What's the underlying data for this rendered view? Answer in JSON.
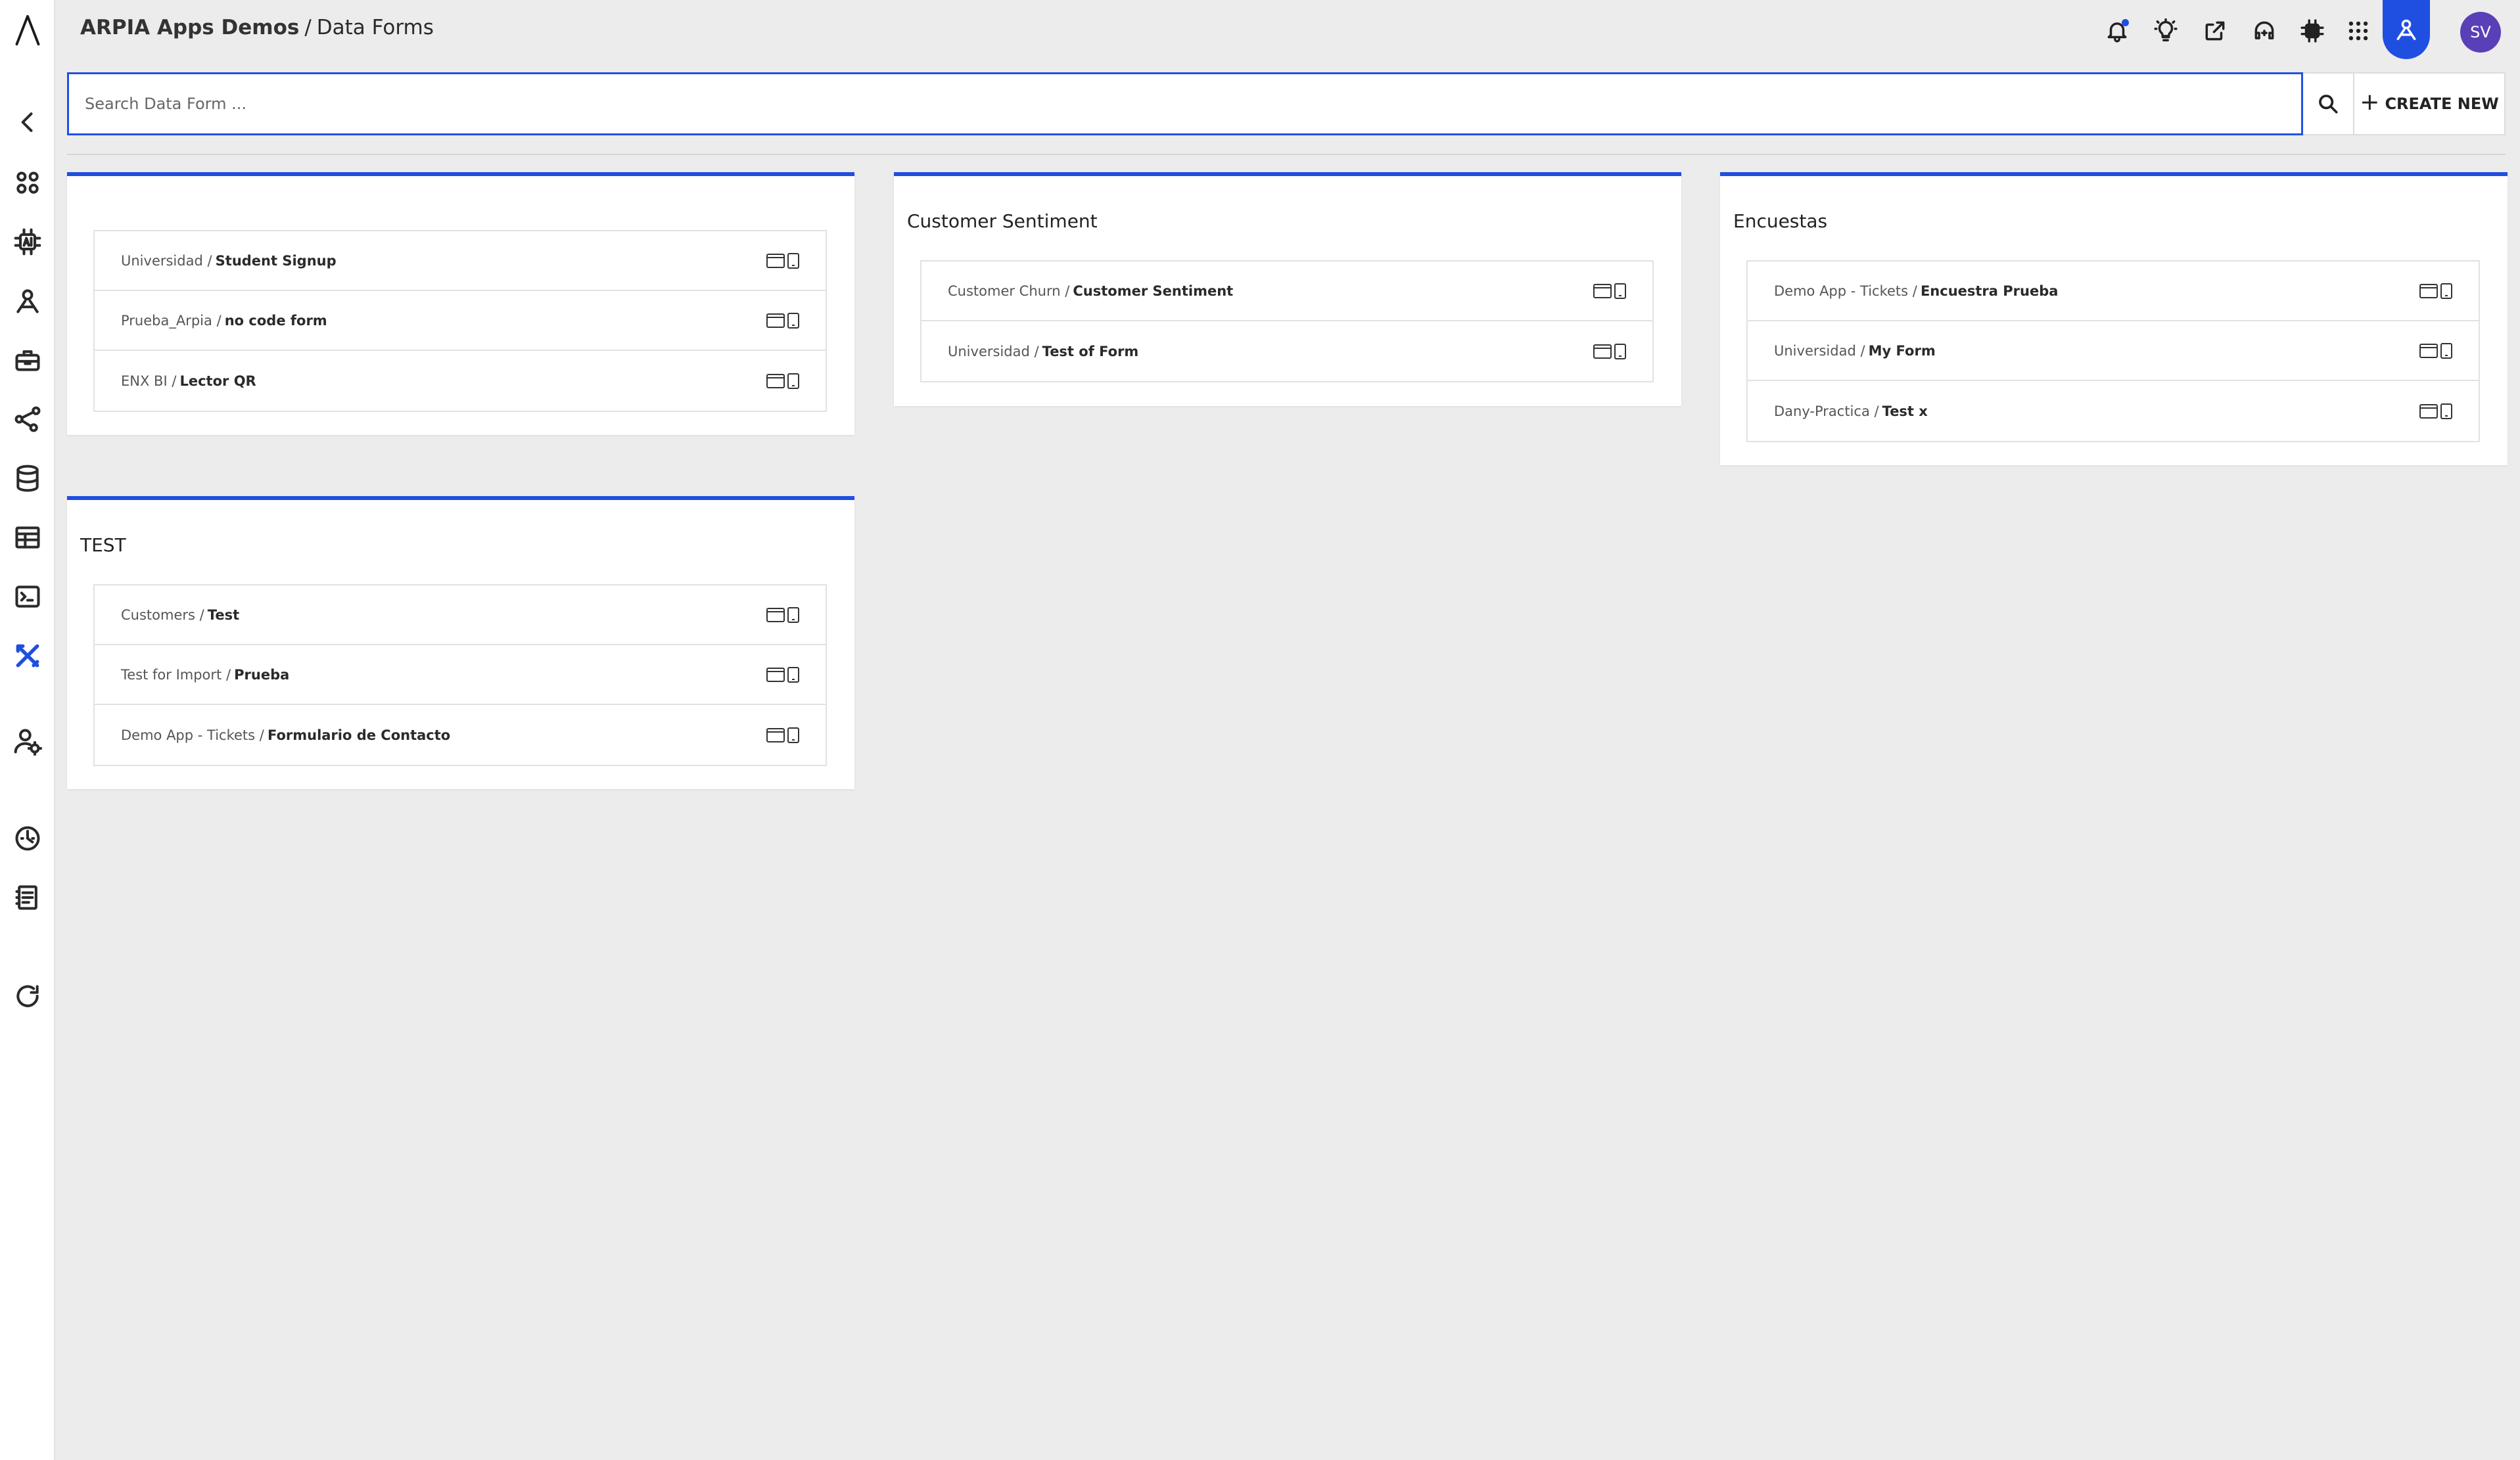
{
  "header": {
    "app_name": "ARPIA Apps Demos",
    "separator": "/",
    "page_title": "Data Forms",
    "avatar_initials": "SV"
  },
  "search": {
    "placeholder": "Search Data Form ...",
    "value": ""
  },
  "toolbar": {
    "create_label": "CREATE NEW"
  },
  "sidebar": {
    "items": [
      {
        "icon": "back-chevron-icon"
      },
      {
        "icon": "apps-grid-icon"
      },
      {
        "icon": "ai-chip-icon"
      },
      {
        "icon": "ai-user-icon"
      },
      {
        "icon": "toolbox-icon"
      },
      {
        "icon": "nodes-icon"
      },
      {
        "icon": "database-icon"
      },
      {
        "icon": "table-icon"
      },
      {
        "icon": "terminal-icon"
      },
      {
        "icon": "tools-icon",
        "active": true
      },
      {
        "icon": "user-settings-icon"
      },
      {
        "icon": "dashboard-gauge-icon"
      },
      {
        "icon": "notebook-icon"
      },
      {
        "icon": "refresh-icon"
      }
    ]
  },
  "colors": {
    "accent": "#1f4fe0",
    "avatar": "#5b3fb8",
    "background": "#ececec"
  },
  "groups": [
    {
      "title": "",
      "forms": [
        {
          "path": "Universidad /",
          "name": "Student Signup"
        },
        {
          "path": "Prueba_Arpia /",
          "name": "no code form"
        },
        {
          "path": "ENX BI /",
          "name": "Lector QR"
        }
      ]
    },
    {
      "title": "Customer Sentiment",
      "forms": [
        {
          "path": "Customer Churn /",
          "name": "Customer Sentiment"
        },
        {
          "path": "Universidad /",
          "name": "Test of Form"
        }
      ]
    },
    {
      "title": "Encuestas",
      "forms": [
        {
          "path": "Demo App - Tickets /",
          "name": "Encuestra Prueba"
        },
        {
          "path": "Universidad /",
          "name": "My Form"
        },
        {
          "path": "Dany-Practica /",
          "name": "Test x"
        }
      ]
    },
    {
      "title": "TEST",
      "forms": [
        {
          "path": "Customers /",
          "name": "Test"
        },
        {
          "path": "Test for Import /",
          "name": "Prueba"
        },
        {
          "path": "Demo App - Tickets /",
          "name": "Formulario de Contacto"
        }
      ]
    }
  ]
}
